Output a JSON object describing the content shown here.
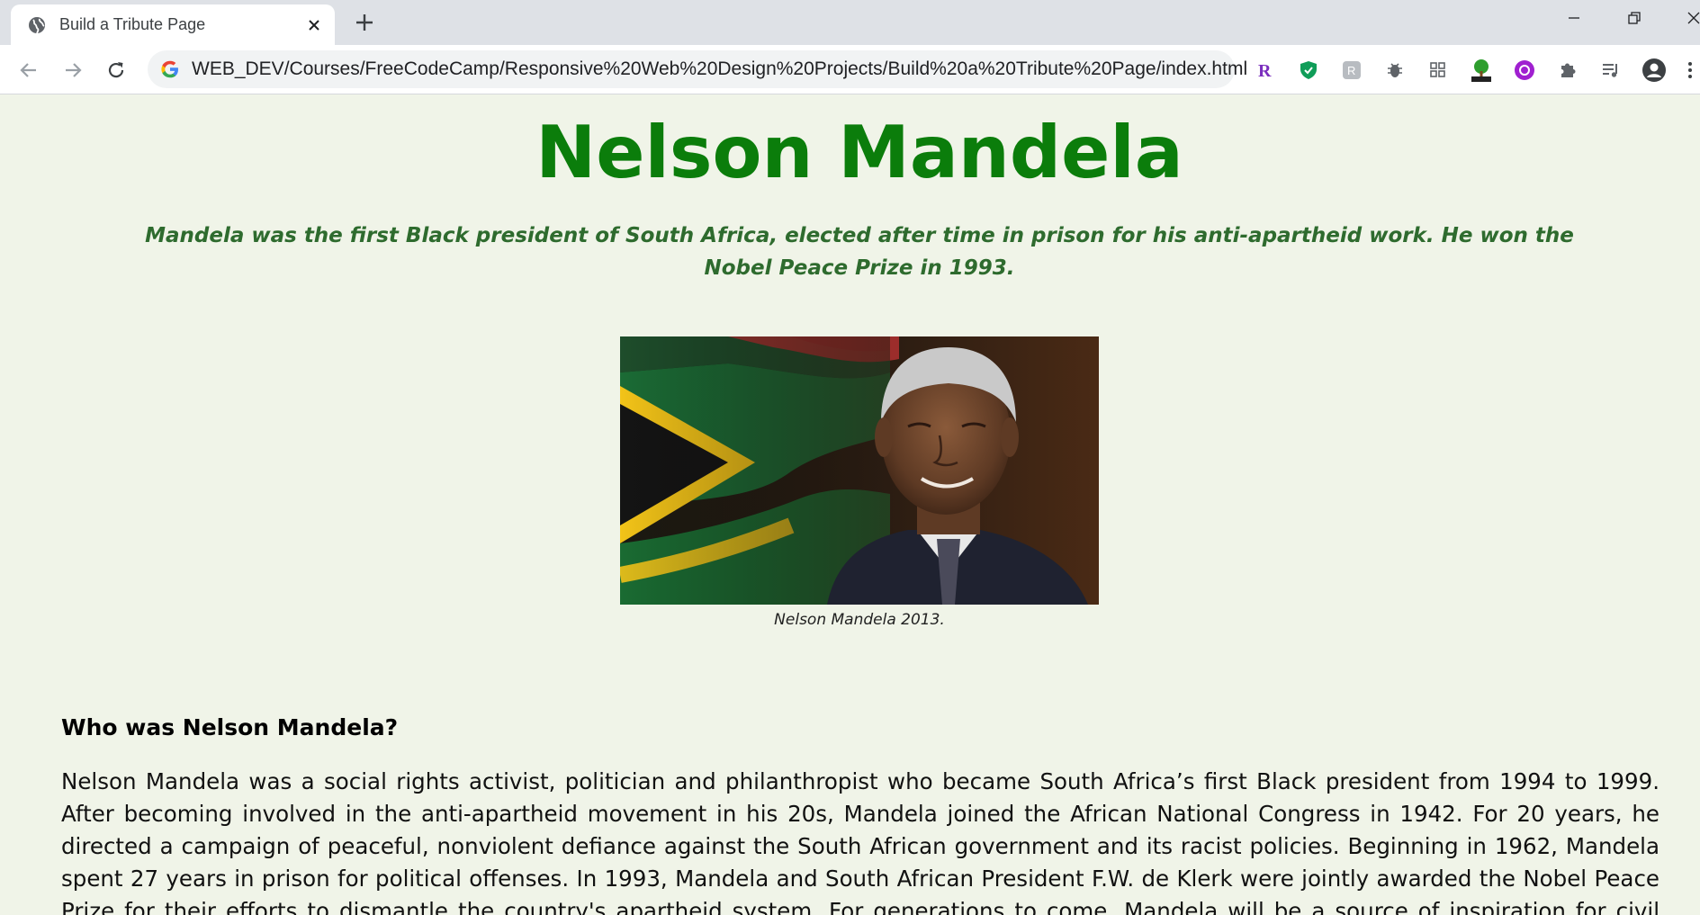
{
  "browser": {
    "tab": {
      "title": "Build a Tribute Page",
      "favicon": "globe-icon"
    },
    "address_bar": {
      "url": "WEB_DEV/Courses/FreeCodeCamp/Responsive%20Web%20Design%20Projects/Build%20a%20Tribute%20Page/index.html",
      "site_icon": "google-icon"
    },
    "extensions": [
      "r-extension-icon",
      "shield-extension-icon",
      "r-badge-extension-icon",
      "bug-extension-icon",
      "grid-extension-icon",
      "html-tree-extension-icon",
      "purple-circle-extension-icon",
      "puzzle-icon",
      "media-queue-icon",
      "profile-avatar-icon",
      "more-menu-icon"
    ]
  },
  "page": {
    "title": "Nelson Mandela",
    "subtitle": "Mandela was the first Black president of South Africa, elected after time in prison for his anti-apartheid work. He won the Nobel Peace Prize in 1993.",
    "image": {
      "description_icon": "photo",
      "caption": "Nelson Mandela 2013."
    },
    "section_heading": "Who was Nelson Mandela?",
    "bio": "Nelson Mandela was a social rights activist, politician and philanthropist who became South Africa’s first Black president from 1994 to 1999. After becoming involved in the anti-apartheid movement in his 20s, Mandela joined the African National Congress in 1942. For 20 years, he directed a campaign of peaceful, nonviolent defiance against the South African government and its racist policies. Beginning in 1962, Mandela spent 27 years in prison for political offenses. In 1993, Mandela and South African President F.W. de Klerk were jointly awarded the Nobel Peace Prize for their efforts to dismantle the country's apartheid system. For generations to come, Mandela will be a source of inspiration for civil rights activists"
  },
  "colors": {
    "title_green": "#0b7d0b",
    "subtitle_green": "#2e6b2e",
    "page_background": "#f0f4e8",
    "tabbar": "#dee1e6"
  }
}
